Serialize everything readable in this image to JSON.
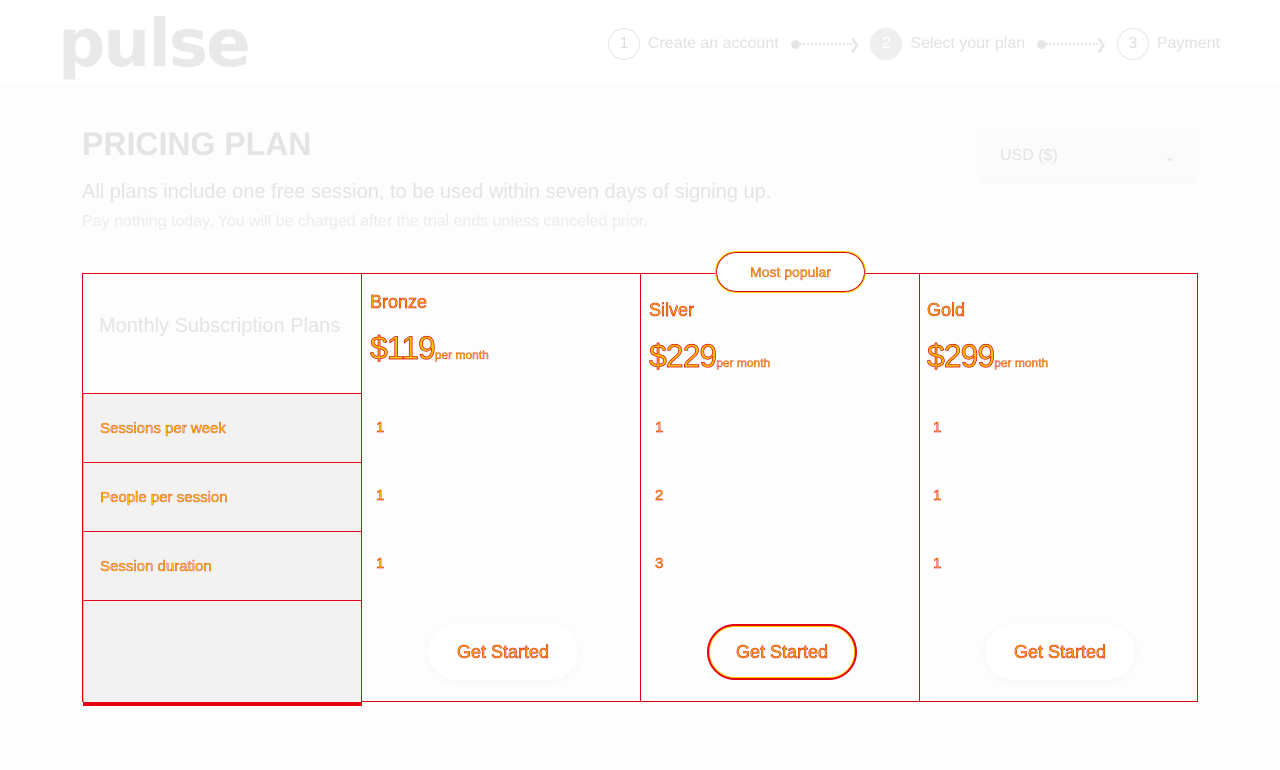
{
  "brand": {
    "logo": "pulse"
  },
  "stepper": [
    {
      "num": "1",
      "label": "Create an account",
      "active": false
    },
    {
      "num": "2",
      "label": "Select your plan",
      "active": true
    },
    {
      "num": "3",
      "label": "Payment",
      "active": false
    }
  ],
  "page": {
    "title": "PRICING PLAN",
    "subtitle": "All plans include one free session, to be used within seven days of signing up.",
    "note": "Pay nothing today. You will be charged after the trial ends unless canceled prior."
  },
  "currency": {
    "selected": "USD ($)"
  },
  "table": {
    "header": "Monthly Subscription Plans",
    "features": [
      "Sessions per week",
      "People per session",
      "Session duration"
    ],
    "badge": "Most popular",
    "plans": [
      {
        "name": "Bronze",
        "price": "$119",
        "period": "per month",
        "values": [
          "1",
          "1",
          "1"
        ],
        "cta": "Get Started"
      },
      {
        "name": "Silver",
        "price": "$229",
        "period": "per month",
        "values": [
          "1",
          "2",
          "3"
        ],
        "cta": "Get Started"
      },
      {
        "name": "Gold",
        "price": "$299",
        "period": "per month",
        "values": [
          "1",
          "1",
          "1"
        ],
        "cta": "Get Started"
      }
    ]
  },
  "colors": {
    "accent": "#e60012",
    "highlight": "#f4d400"
  }
}
